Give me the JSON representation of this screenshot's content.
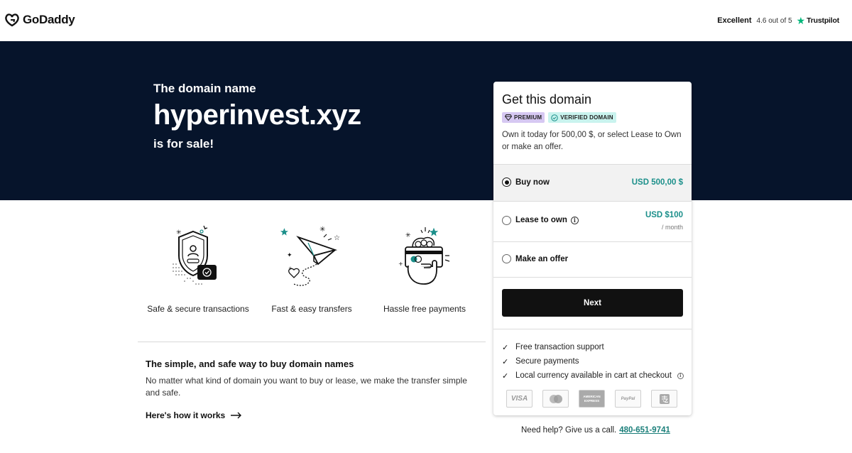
{
  "header": {
    "brand": "GoDaddy",
    "trust_label": "Excellent",
    "trust_rating": "4.6 out of 5",
    "trust_brand": "Trustpilot",
    "trust_color": "#00b67a"
  },
  "hero": {
    "pre": "The domain name",
    "domain": "hyperinvest.xyz",
    "post": "is for sale!",
    "background": "#06142b"
  },
  "features": [
    {
      "label": "Safe & secure transactions",
      "icon": "shield-check-icon"
    },
    {
      "label": "Fast & easy transfers",
      "icon": "paper-plane-icon"
    },
    {
      "label": "Hassle free payments",
      "icon": "card-hand-icon"
    }
  ],
  "info": {
    "title": "The simple, and safe way to buy domain names",
    "body": "No matter what kind of domain you want to buy or lease, we make the transfer simple and safe.",
    "link": "Here's how it works"
  },
  "card": {
    "title": "Get this domain",
    "badges": {
      "premium": "PREMIUM",
      "verified": "VERIFIED DOMAIN"
    },
    "description": "Own it today for 500,00 $, or select Lease to Own or make an offer.",
    "options": {
      "buy": {
        "label": "Buy now",
        "price": "USD 500,00 $",
        "selected": true
      },
      "lease": {
        "label": "Lease to own",
        "price": "USD $100",
        "sub": "/ month",
        "selected": false
      },
      "offer": {
        "label": "Make an offer",
        "selected": false
      }
    },
    "next_label": "Next",
    "benefits": [
      "Free transaction support",
      "Secure payments",
      "Local currency available in cart at checkout"
    ],
    "payment_methods": [
      "VISA",
      "mastercard",
      "AMERICAN EXPRESS",
      "PayPal",
      "Alipay"
    ],
    "accent_color": "#1b8f8a"
  },
  "help": {
    "text": "Need help? Give us a call.",
    "phone": "480-651-9741"
  }
}
